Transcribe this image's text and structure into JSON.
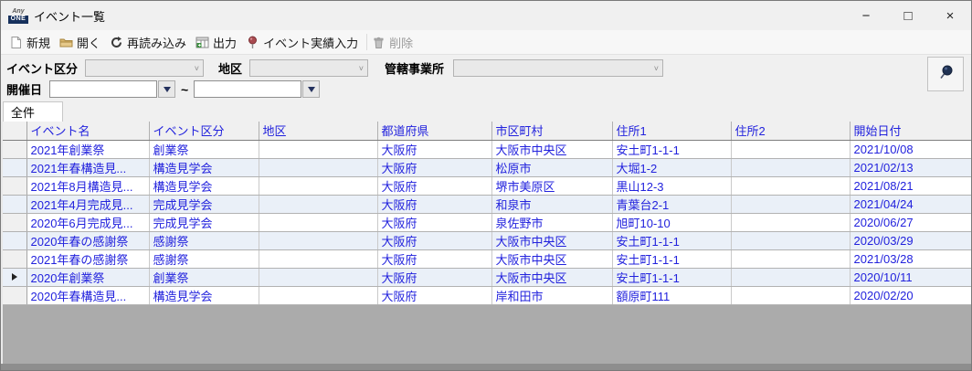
{
  "window": {
    "title": "イベント一覧",
    "logo": {
      "line1": "Any",
      "line2": "ONE"
    },
    "controls": {
      "minimize": "−",
      "maximize": "□",
      "close": "×"
    }
  },
  "toolbar": {
    "new_label": "新規",
    "open_label": "開く",
    "reload_label": "再読み込み",
    "output_label": "出力",
    "event_result_label": "イベント実績入力",
    "delete_label": "削除"
  },
  "filters": {
    "event_category_label": "イベント区分",
    "event_category_value": "",
    "district_label": "地区",
    "district_value": "",
    "office_label": "管轄事業所",
    "office_value": "",
    "event_date_label": "開催日",
    "date_from_value": "",
    "date_to_value": "",
    "range_separator": "~"
  },
  "tab": {
    "label": "全件"
  },
  "table": {
    "columns": [
      "イベント名",
      "イベント区分",
      "地区",
      "都道府県",
      "市区町村",
      "住所1",
      "住所2",
      "開始日付"
    ],
    "current_row_index": 7,
    "rows": [
      {
        "event_name": "2021年創業祭",
        "category": "創業祭",
        "district": "",
        "prefecture": "大阪府",
        "city": "大阪市中央区",
        "address1": "安土町1-1-1",
        "address2": "",
        "start_date": "2021/10/08"
      },
      {
        "event_name": "2021年春構造見...",
        "category": "構造見学会",
        "district": "",
        "prefecture": "大阪府",
        "city": "松原市",
        "address1": "大堀1-2",
        "address2": "",
        "start_date": "2021/02/13"
      },
      {
        "event_name": "2021年8月構造見...",
        "category": "構造見学会",
        "district": "",
        "prefecture": "大阪府",
        "city": "堺市美原区",
        "address1": "黒山12-3",
        "address2": "",
        "start_date": "2021/08/21"
      },
      {
        "event_name": "2021年4月完成見...",
        "category": "完成見学会",
        "district": "",
        "prefecture": "大阪府",
        "city": "和泉市",
        "address1": "青葉台2-1",
        "address2": "",
        "start_date": "2021/04/24"
      },
      {
        "event_name": "2020年6月完成見...",
        "category": "完成見学会",
        "district": "",
        "prefecture": "大阪府",
        "city": "泉佐野市",
        "address1": "旭町10-10",
        "address2": "",
        "start_date": "2020/06/27"
      },
      {
        "event_name": "2020年春の感謝祭",
        "category": "感謝祭",
        "district": "",
        "prefecture": "大阪府",
        "city": "大阪市中央区",
        "address1": "安土町1-1-1",
        "address2": "",
        "start_date": "2020/03/29"
      },
      {
        "event_name": "2021年春の感謝祭",
        "category": "感謝祭",
        "district": "",
        "prefecture": "大阪府",
        "city": "大阪市中央区",
        "address1": "安土町1-1-1",
        "address2": "",
        "start_date": "2021/03/28"
      },
      {
        "event_name": "2020年創業祭",
        "category": "創業祭",
        "district": "",
        "prefecture": "大阪府",
        "city": "大阪市中央区",
        "address1": "安土町1-1-1",
        "address2": "",
        "start_date": "2020/10/11"
      },
      {
        "event_name": "2020年春構造見...",
        "category": "構造見学会",
        "district": "",
        "prefecture": "大阪府",
        "city": "岸和田市",
        "address1": "額原町111",
        "address2": "",
        "start_date": "2020/02/20"
      }
    ]
  },
  "colors": {
    "grid_text": "#2222DD",
    "alt_row": "#EAF0F8",
    "grid_background": "#ABABAB",
    "pin_red": "#A84A50",
    "pin_navy": "#203253",
    "folder_tan": "#D8B56D"
  }
}
